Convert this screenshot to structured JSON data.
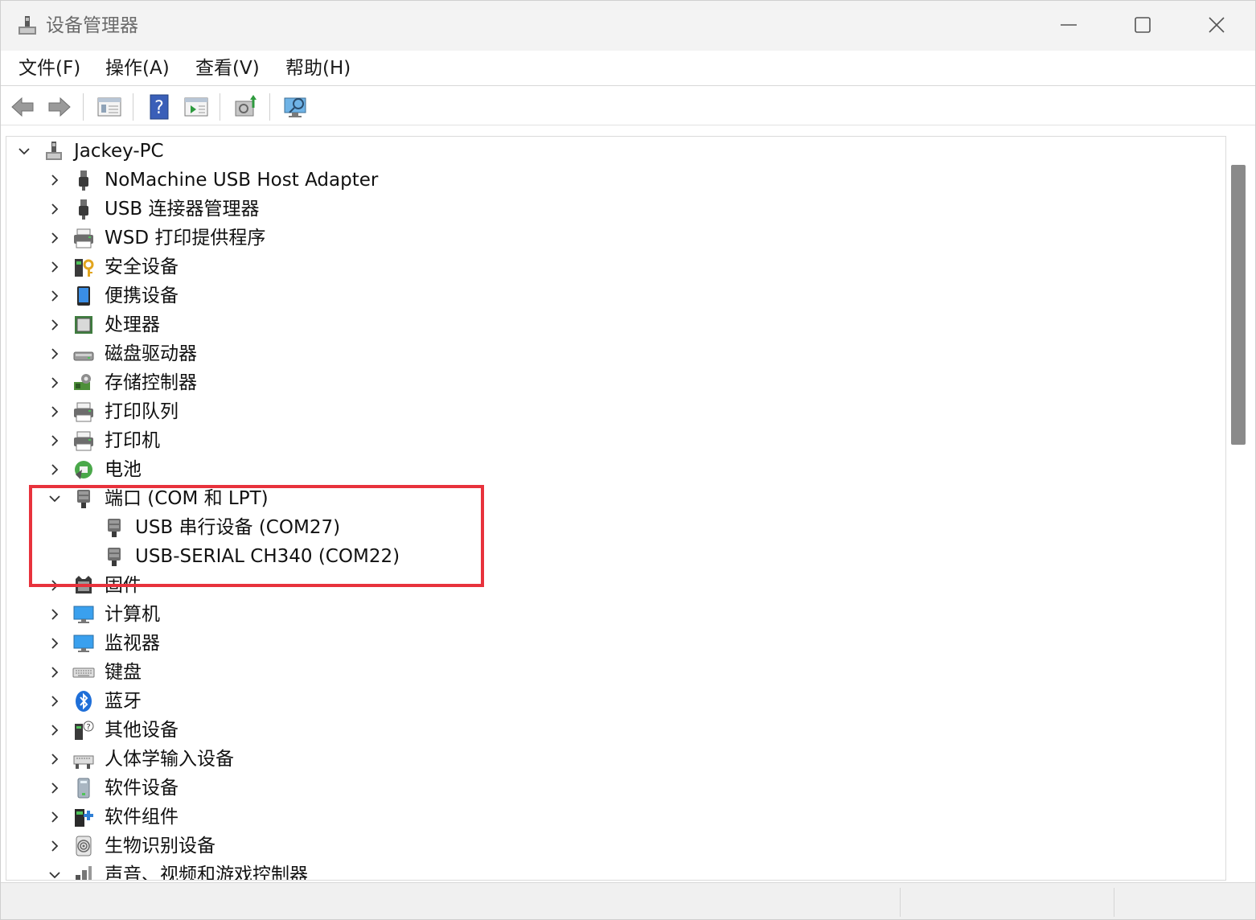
{
  "window": {
    "title": "设备管理器"
  },
  "menu": [
    {
      "label": "文件(F)"
    },
    {
      "label": "操作(A)"
    },
    {
      "label": "查看(V)"
    },
    {
      "label": "帮助(H)"
    }
  ],
  "toolbar": [
    "back-icon",
    "forward-icon",
    "properties-icon",
    "help-icon",
    "driver-update-icon",
    "scan-hardware-icon",
    "monitor-icon"
  ],
  "tree": {
    "root": "Jackey-PC",
    "items": [
      {
        "label": "NoMachine USB Host Adapter",
        "icon": "usb-icon"
      },
      {
        "label": "USB 连接器管理器",
        "icon": "usb-icon"
      },
      {
        "label": "WSD 打印提供程序",
        "icon": "printer-icon"
      },
      {
        "label": "安全设备",
        "icon": "security-key-icon"
      },
      {
        "label": "便携设备",
        "icon": "portable-device-icon"
      },
      {
        "label": "处理器",
        "icon": "processor-icon"
      },
      {
        "label": "磁盘驱动器",
        "icon": "disk-drive-icon"
      },
      {
        "label": "存储控制器",
        "icon": "storage-controller-icon"
      },
      {
        "label": "打印队列",
        "icon": "printer-icon"
      },
      {
        "label": "打印机",
        "icon": "printer-icon"
      },
      {
        "label": "电池",
        "icon": "battery-icon"
      },
      {
        "label": "端口 (COM 和 LPT)",
        "icon": "port-icon",
        "expanded": true,
        "children": [
          {
            "label": "USB 串行设备 (COM27)",
            "icon": "port-icon"
          },
          {
            "label": "USB-SERIAL CH340 (COM22)",
            "icon": "port-icon"
          }
        ]
      },
      {
        "label": "固件",
        "icon": "firmware-icon"
      },
      {
        "label": "计算机",
        "icon": "computer-icon"
      },
      {
        "label": "监视器",
        "icon": "monitor-icon"
      },
      {
        "label": "键盘",
        "icon": "keyboard-icon"
      },
      {
        "label": "蓝牙",
        "icon": "bluetooth-icon"
      },
      {
        "label": "其他设备",
        "icon": "unknown-device-icon"
      },
      {
        "label": "人体学输入设备",
        "icon": "hid-icon"
      },
      {
        "label": "软件设备",
        "icon": "software-device-icon"
      },
      {
        "label": "软件组件",
        "icon": "software-component-icon"
      },
      {
        "label": "生物识别设备",
        "icon": "biometric-icon"
      },
      {
        "label": "声音、视频和游戏控制器",
        "icon": "sound-icon",
        "expanded": true
      }
    ]
  },
  "colors": {
    "highlight": "#e8323c",
    "scroll_thumb": "#8a8a8a",
    "titlebar": "#f3f3f3"
  }
}
